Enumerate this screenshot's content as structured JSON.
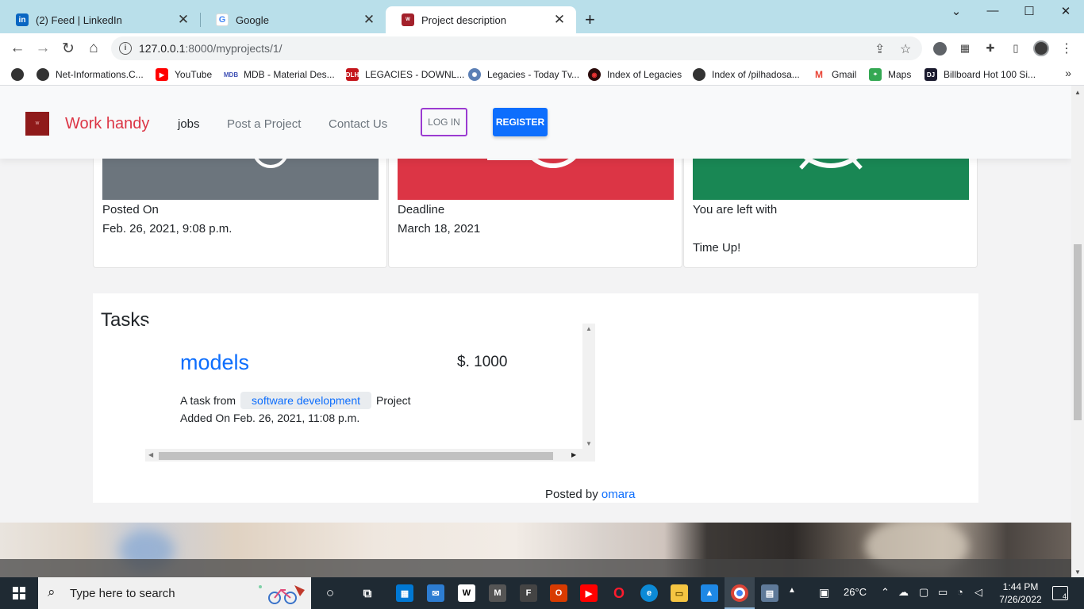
{
  "browser": {
    "tabs": [
      {
        "label": "(2) Feed | LinkedIn",
        "icon": "linkedin-icon",
        "active": false
      },
      {
        "label": "Google",
        "icon": "google-icon",
        "active": false
      },
      {
        "label": "Project description",
        "icon": "site-favicon",
        "active": true
      }
    ],
    "url_host": "127.0.0.1",
    "url_path": ":8000/myprojects/1/",
    "bookmarks": [
      {
        "label": "Net-Informations.C...",
        "icon": "globe-icon"
      },
      {
        "label": "YouTube",
        "icon": "youtube-icon"
      },
      {
        "label": "MDB - Material Des...",
        "icon": "mdb-icon"
      },
      {
        "label": "LEGACIES - DOWNL...",
        "icon": "dlh-icon"
      },
      {
        "label": "Legacies - Today Tv...",
        "icon": "film-icon"
      },
      {
        "label": "Index of Legacies",
        "icon": "dark-globe-icon"
      },
      {
        "label": "Index of /pilhadosa...",
        "icon": "globe-icon"
      },
      {
        "label": "Gmail",
        "icon": "gmail-icon"
      },
      {
        "label": "Maps",
        "icon": "maps-icon"
      },
      {
        "label": "Billboard Hot 100 Si...",
        "icon": "dj-icon"
      }
    ]
  },
  "site": {
    "brand": "Work handy",
    "nav": {
      "jobs": "jobs",
      "post_project": "Post a Project",
      "contact": "Contact Us",
      "login": "LOG IN",
      "register": "REGISTER"
    },
    "cards": {
      "posted": {
        "label": "Posted On",
        "value": "Feb. 26, 2021, 9:08 p.m."
      },
      "deadline": {
        "label": "Deadline",
        "value": "March 18, 2021"
      },
      "remaining": {
        "label": "You are left with",
        "value": "Time Up!"
      }
    },
    "tasks": {
      "title": "Tasks",
      "items": [
        {
          "name": "models",
          "price": "$. 1000",
          "prefix": "A task from",
          "category": "software development",
          "suffix": "Project",
          "added": "Added On Feb. 26, 2021, 11:08 p.m."
        }
      ]
    },
    "posted_by_label": "Posted by",
    "posted_by_user": "omara"
  },
  "colors": {
    "brand_red": "#dc3545",
    "card_gray": "#6c757d",
    "card_red": "#dc3545",
    "card_green": "#198754",
    "primary_blue": "#0d6efd"
  },
  "taskbar": {
    "search_placeholder": "Type here to search",
    "weather": "26°C",
    "time": "1:44 PM",
    "date": "7/26/2022",
    "notifications": "4"
  }
}
